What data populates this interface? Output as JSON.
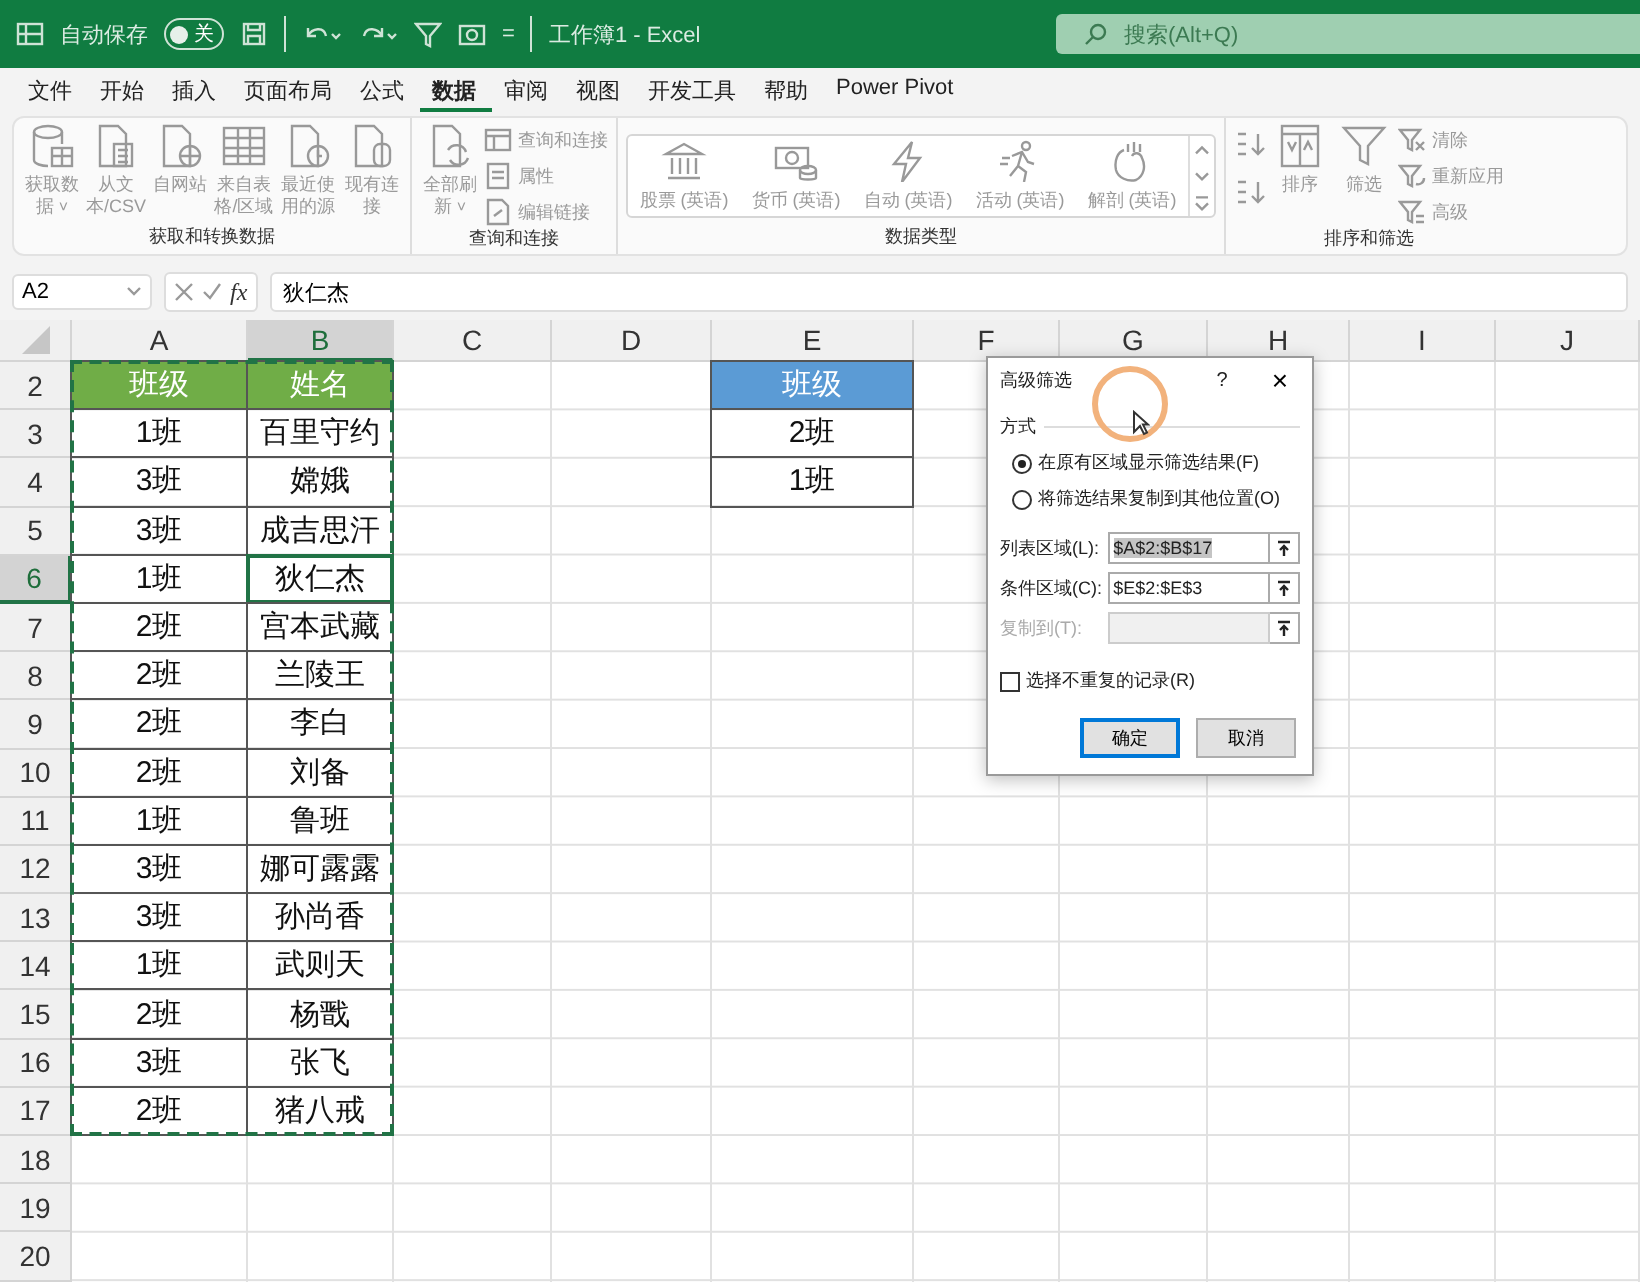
{
  "title_bar": {
    "autosave_label": "自动保存",
    "autosave_state": "关",
    "autosave_on": false,
    "customize_glyph": "=",
    "title": "工作簿1 - Excel",
    "search_placeholder": "搜索(Alt+Q)"
  },
  "menu_tabs": [
    {
      "label": "文件",
      "selected": false
    },
    {
      "label": "开始",
      "selected": false
    },
    {
      "label": "插入",
      "selected": false
    },
    {
      "label": "页面布局",
      "selected": false
    },
    {
      "label": "公式",
      "selected": false
    },
    {
      "label": "数据",
      "selected": true
    },
    {
      "label": "审阅",
      "selected": false
    },
    {
      "label": "视图",
      "selected": false
    },
    {
      "label": "开发工具",
      "selected": false
    },
    {
      "label": "帮助",
      "selected": false
    },
    {
      "label": "Power Pivot",
      "selected": false
    }
  ],
  "ribbon_groups": [
    {
      "title": "获取和转换数据",
      "items": [
        {
          "kind": "large",
          "label": "获取数据",
          "caret": "˅"
        },
        {
          "kind": "large",
          "label": "从文本/CSV"
        },
        {
          "kind": "large",
          "label": "自网站"
        },
        {
          "kind": "large",
          "label": "来自表格/区域"
        },
        {
          "kind": "large",
          "label": "最近使用的源"
        },
        {
          "kind": "large",
          "label": "现有连接"
        }
      ]
    },
    {
      "title": "查询和连接",
      "items": [
        {
          "kind": "large",
          "label": "全部刷新",
          "caret": "˅"
        },
        {
          "kind": "small",
          "label": "查询和连接"
        },
        {
          "kind": "small",
          "label": "属性"
        },
        {
          "kind": "small",
          "label": "编辑链接"
        }
      ]
    },
    {
      "title": "数据类型",
      "items": [
        {
          "kind": "gallery",
          "label": "股票 (英语)"
        },
        {
          "kind": "gallery",
          "label": "货币 (英语)"
        },
        {
          "kind": "gallery",
          "label": "自动 (英语)"
        },
        {
          "kind": "gallery",
          "label": "活动 (英语)"
        },
        {
          "kind": "gallery",
          "label": "解剖 (英语)"
        }
      ]
    },
    {
      "title": "排序和筛选",
      "items": [
        {
          "kind": "sortpair"
        },
        {
          "kind": "large",
          "label": "排序"
        },
        {
          "kind": "large",
          "label": "筛选"
        },
        {
          "kind": "small",
          "label": "清除"
        },
        {
          "kind": "small",
          "label": "重新应用"
        },
        {
          "kind": "small",
          "label": "高级"
        }
      ]
    }
  ],
  "formula_bar": {
    "name_box": "A2",
    "fx": "fx",
    "formula": "狄仁杰"
  },
  "sheet": {
    "columns": [
      {
        "label": "A",
        "selected": false
      },
      {
        "label": "B",
        "selected": true
      },
      {
        "label": "C",
        "selected": false
      },
      {
        "label": "D",
        "selected": false
      },
      {
        "label": "E",
        "selected": false
      },
      {
        "label": "F",
        "selected": false
      },
      {
        "label": "G",
        "selected": false
      },
      {
        "label": "H",
        "selected": false
      },
      {
        "label": "I",
        "selected": false
      },
      {
        "label": "J",
        "selected": false
      }
    ],
    "row_numbers": [
      {
        "label": "2",
        "selected": false
      },
      {
        "label": "3",
        "selected": false
      },
      {
        "label": "4",
        "selected": false
      },
      {
        "label": "5",
        "selected": false
      },
      {
        "label": "6",
        "selected": true
      },
      {
        "label": "7",
        "selected": false
      },
      {
        "label": "8",
        "selected": false
      },
      {
        "label": "9",
        "selected": false
      },
      {
        "label": "10",
        "selected": false
      },
      {
        "label": "11",
        "selected": false
      },
      {
        "label": "12",
        "selected": false
      },
      {
        "label": "13",
        "selected": false
      },
      {
        "label": "14",
        "selected": false
      },
      {
        "label": "15",
        "selected": false
      },
      {
        "label": "16",
        "selected": false
      },
      {
        "label": "17",
        "selected": false
      },
      {
        "label": "18",
        "selected": false
      },
      {
        "label": "19",
        "selected": false
      },
      {
        "label": "20",
        "selected": false
      }
    ],
    "list_range": {
      "headers": [
        "班级",
        "姓名"
      ],
      "rows": [
        {
          "cells": [
            "1班",
            "百里守约"
          ],
          "selected": false
        },
        {
          "cells": [
            "3班",
            "嫦娥"
          ],
          "selected": false
        },
        {
          "cells": [
            "3班",
            "成吉思汗"
          ],
          "selected": false
        },
        {
          "cells": [
            "1班",
            "狄仁杰"
          ],
          "selected": true
        },
        {
          "cells": [
            "2班",
            "宫本武藏"
          ],
          "selected": false
        },
        {
          "cells": [
            "2班",
            "兰陵王"
          ],
          "selected": false
        },
        {
          "cells": [
            "2班",
            "李白"
          ],
          "selected": false
        },
        {
          "cells": [
            "2班",
            "刘备"
          ],
          "selected": false
        },
        {
          "cells": [
            "1班",
            "鲁班"
          ],
          "selected": false
        },
        {
          "cells": [
            "3班",
            "娜可露露"
          ],
          "selected": false
        },
        {
          "cells": [
            "3班",
            "孙尚香"
          ],
          "selected": false
        },
        {
          "cells": [
            "1班",
            "武则天"
          ],
          "selected": false
        },
        {
          "cells": [
            "2班",
            "杨戬"
          ],
          "selected": false
        },
        {
          "cells": [
            "3班",
            "张飞"
          ],
          "selected": false
        },
        {
          "cells": [
            "2班",
            "猪八戒"
          ],
          "selected": false
        }
      ]
    },
    "criteria_range": {
      "header": "班级",
      "values": [
        "2班",
        "1班"
      ]
    }
  },
  "dialog": {
    "title": "高级筛选",
    "help": "?",
    "close": "×",
    "section": "方式",
    "modes": [
      {
        "label": "在原有区域显示筛选结果(F)",
        "selected": true
      },
      {
        "label": "将筛选结果复制到其他位置(O)",
        "selected": false
      }
    ],
    "fields": [
      {
        "label": "列表区域(L):",
        "value": "$A$2:$B$17",
        "disabled": false,
        "highlighted": true
      },
      {
        "label": "条件区域(C):",
        "value": "$E$2:$E$3",
        "disabled": false,
        "highlighted": false
      },
      {
        "label": "复制到(T):",
        "disabled": true
      }
    ],
    "unique_checkbox": {
      "label": "选择不重复的记录(R)",
      "checked": false
    },
    "buttons": [
      {
        "label": "确定",
        "kind": "default"
      },
      {
        "label": "取消",
        "kind": "normal"
      }
    ]
  }
}
